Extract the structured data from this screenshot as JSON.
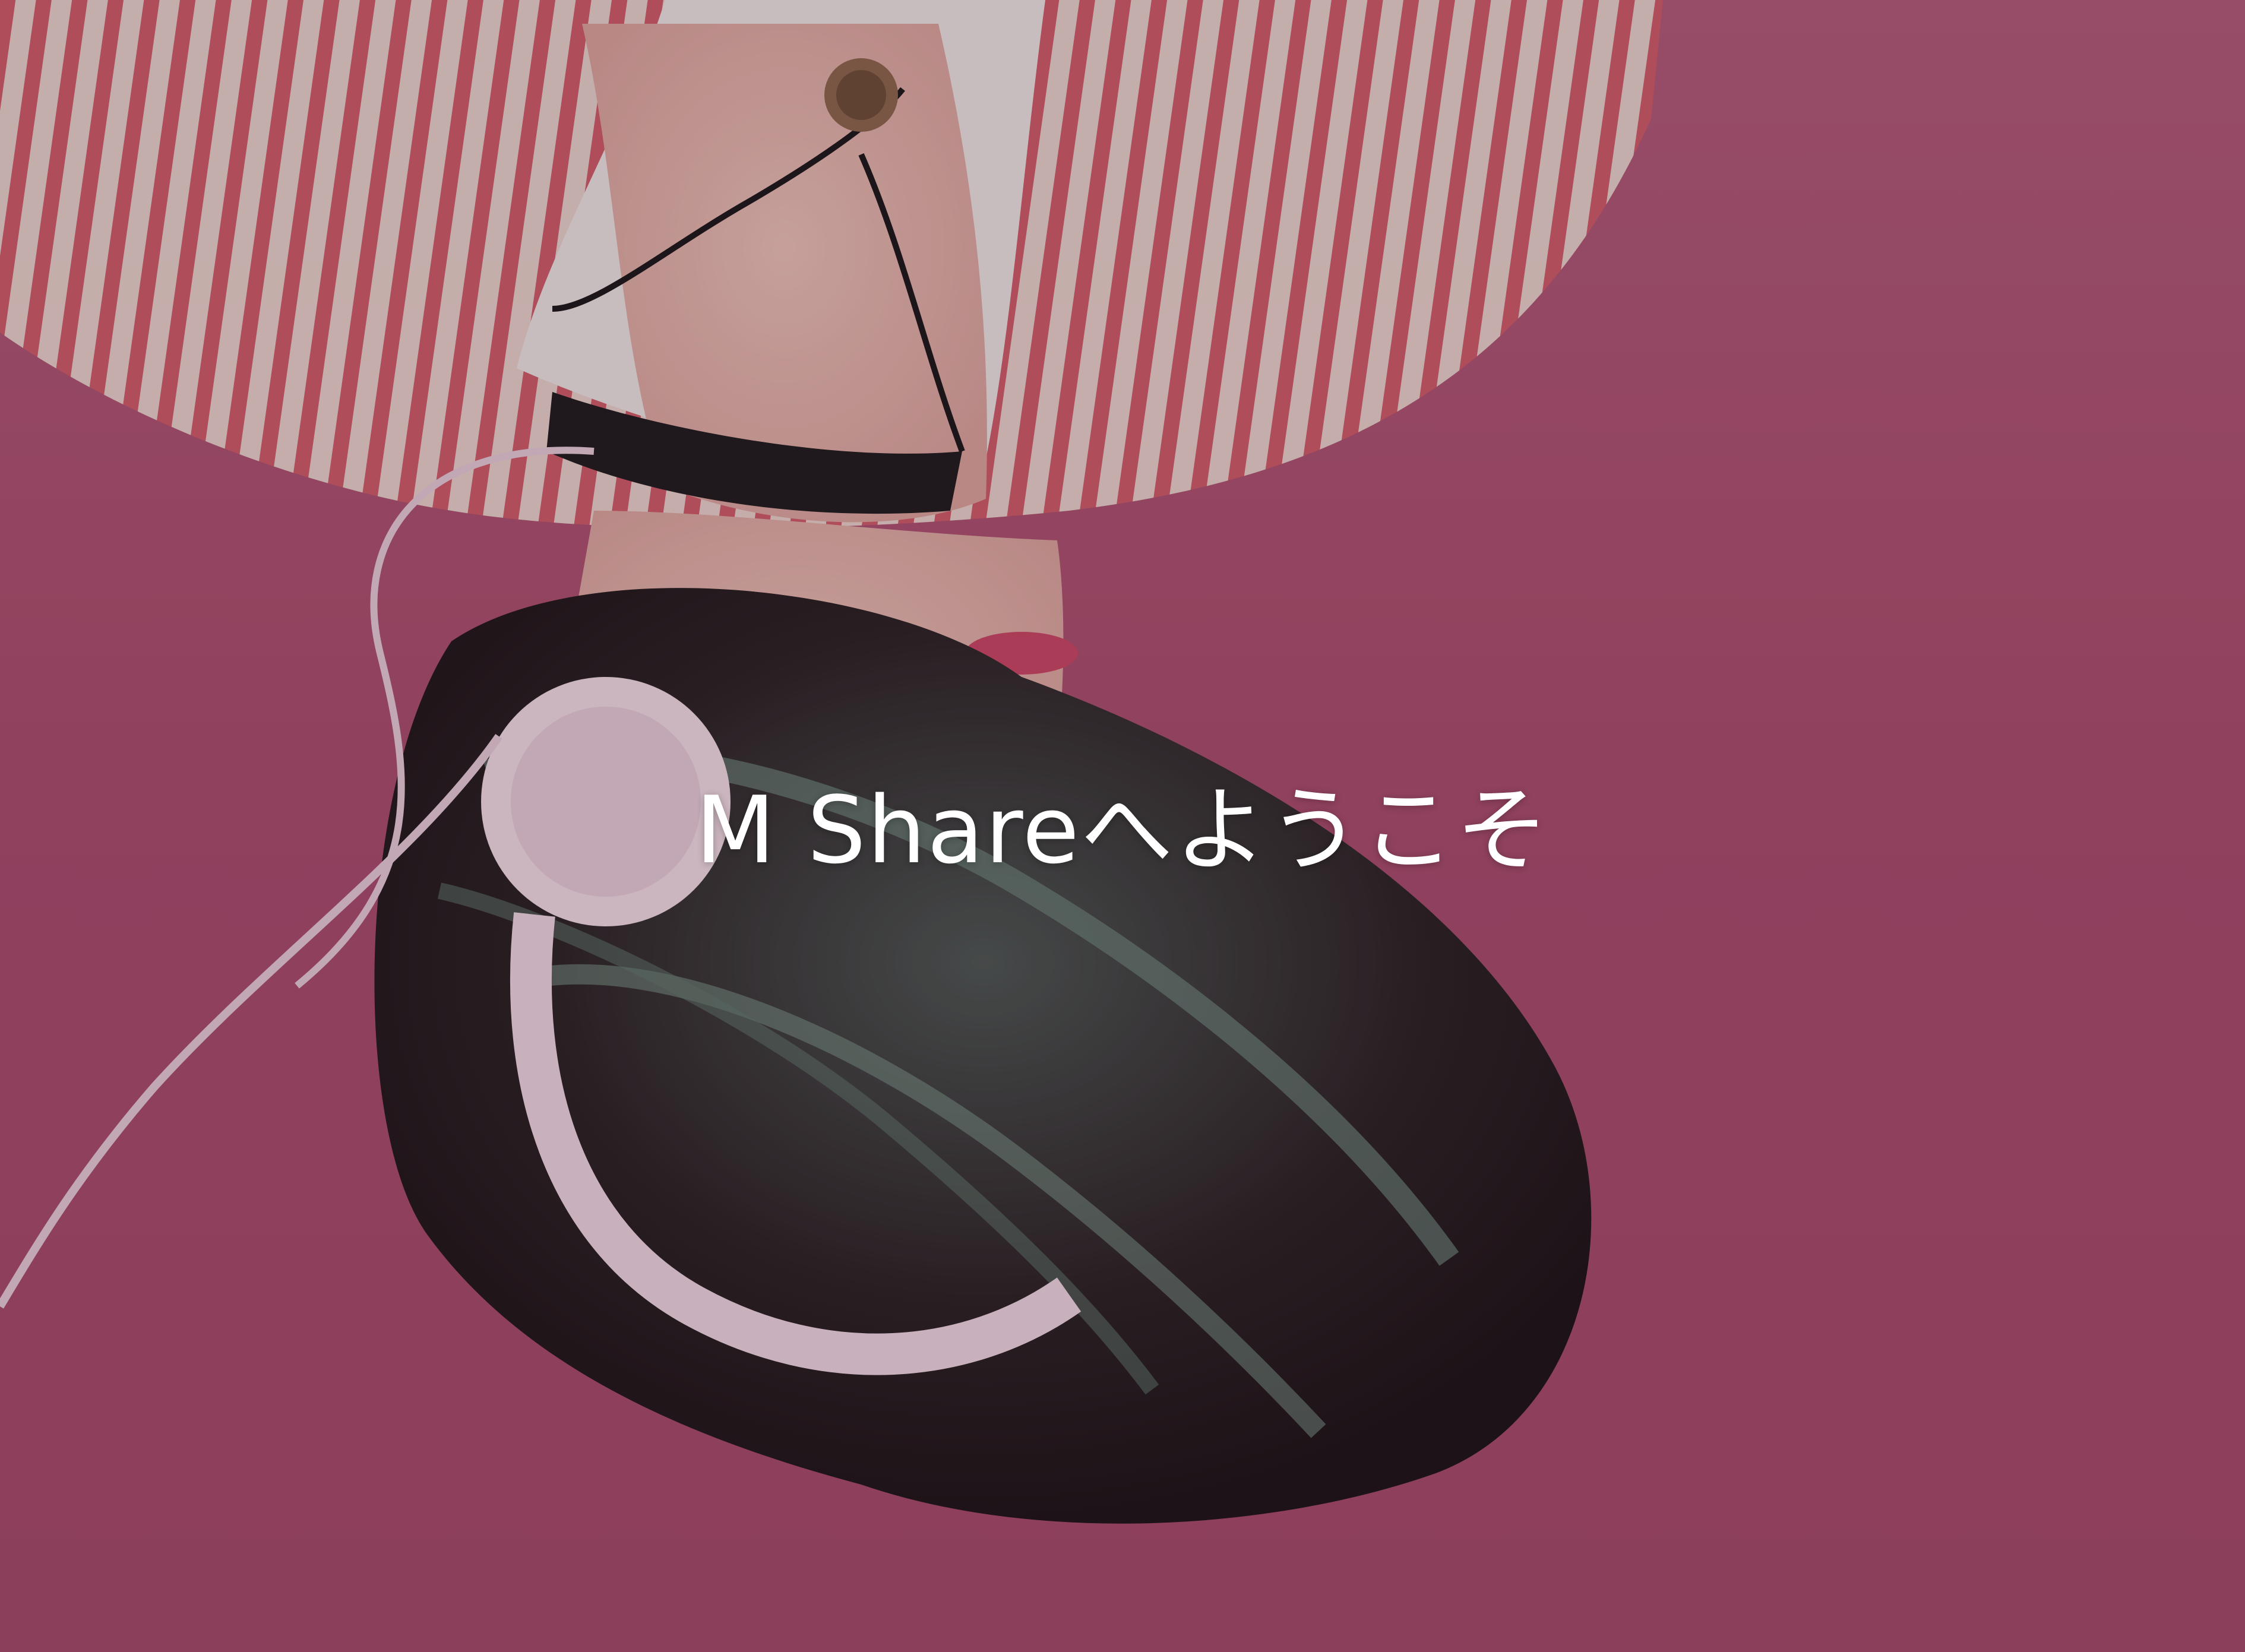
{
  "hero": {
    "title": "M Shareへようこそ",
    "background_color": "#a8506e",
    "image_subject": "photo-background"
  }
}
